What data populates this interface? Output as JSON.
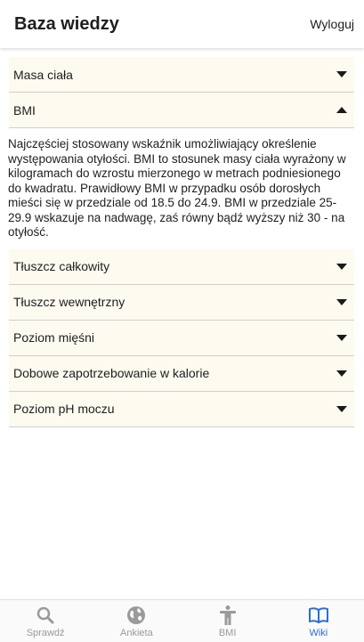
{
  "header": {
    "title": "Baza wiedzy",
    "logout_label": "Wyloguj"
  },
  "accordion": [
    {
      "label": "Masa ciała",
      "expanded": false
    },
    {
      "label": "BMI",
      "expanded": true,
      "body": "Najczęściej stosowany wskaźnik umożliwiający określenie występowania otyłości. BMI to stosunek masy ciała wyrażony w kilogramach do wzrostu mierzonego w metrach podniesionego do kwadratu. Prawidłowy BMI w przypadku osób dorosłych mieści się w przedziale od 18.5 do 24.9. BMI w przedziale 25-29.9 wskazuje na nadwagę, zaś równy bądź wyższy niż 30 - na otyłość."
    },
    {
      "label": "Tłuszcz całkowity",
      "expanded": false
    },
    {
      "label": "Tłuszcz wewnętrzny",
      "expanded": false
    },
    {
      "label": "Poziom mięśni",
      "expanded": false
    },
    {
      "label": "Dobowe zapotrzebowanie w kalorie",
      "expanded": false
    },
    {
      "label": "Poziom pH moczu",
      "expanded": false
    }
  ],
  "bottom_nav": [
    {
      "label": "Sprawdź",
      "icon": "search-icon",
      "active": false
    },
    {
      "label": "Ankieta",
      "icon": "globe-icon",
      "active": false
    },
    {
      "label": "BMI",
      "icon": "person-icon",
      "active": false
    },
    {
      "label": "Wiki",
      "icon": "book-icon",
      "active": true
    }
  ],
  "colors": {
    "accent": "#2a6fd6",
    "inactive": "#9a9a9a",
    "accordion_bg": "#fdfaf0"
  }
}
